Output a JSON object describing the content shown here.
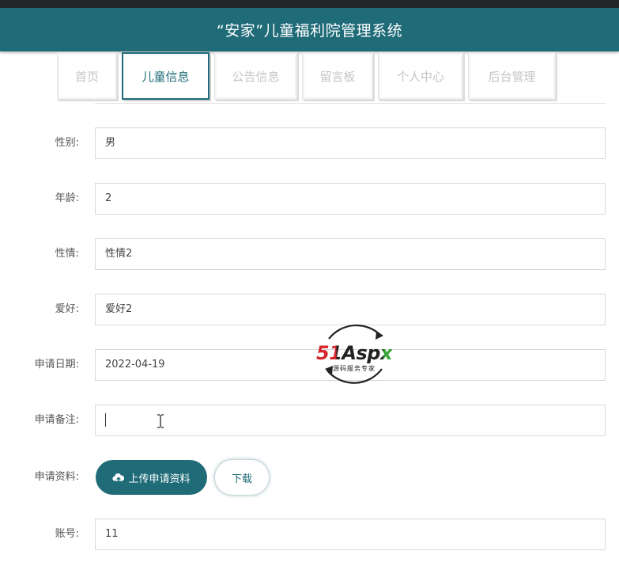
{
  "header": {
    "title": "“安家”儿童福利院管理系统"
  },
  "nav": {
    "tabs": [
      {
        "label": "首页",
        "active": false
      },
      {
        "label": "儿童信息",
        "active": true
      },
      {
        "label": "公告信息",
        "active": false
      },
      {
        "label": "留言板",
        "active": false
      },
      {
        "label": "个人中心",
        "active": false
      },
      {
        "label": "后台管理",
        "active": false
      }
    ]
  },
  "form": {
    "gender": {
      "label": "性别:",
      "value": "男"
    },
    "age": {
      "label": "年龄:",
      "value": "2"
    },
    "temperament": {
      "label": "性情:",
      "value": "性情2"
    },
    "hobby": {
      "label": "爱好:",
      "value": "爱好2"
    },
    "apply_date": {
      "label": "申请日期:",
      "value": "2022-04-19"
    },
    "apply_note": {
      "label": "申请备注:",
      "value": ""
    },
    "apply_material": {
      "label": "申请资料:",
      "upload_label": "上传申请资料",
      "download_label": "下载"
    },
    "account": {
      "label": "账号:",
      "value": "11"
    }
  },
  "watermark": {
    "brand": "51Aspx",
    "tagline": "源码服务专家"
  },
  "colors": {
    "primary": "#1f6b78",
    "header_bg": "#1f6b78",
    "watermark_red": "#d4262c",
    "watermark_green": "#3aa63a"
  },
  "icons": {
    "upload": "cloud-upload-icon",
    "cursor": "text-cursor-icon"
  }
}
